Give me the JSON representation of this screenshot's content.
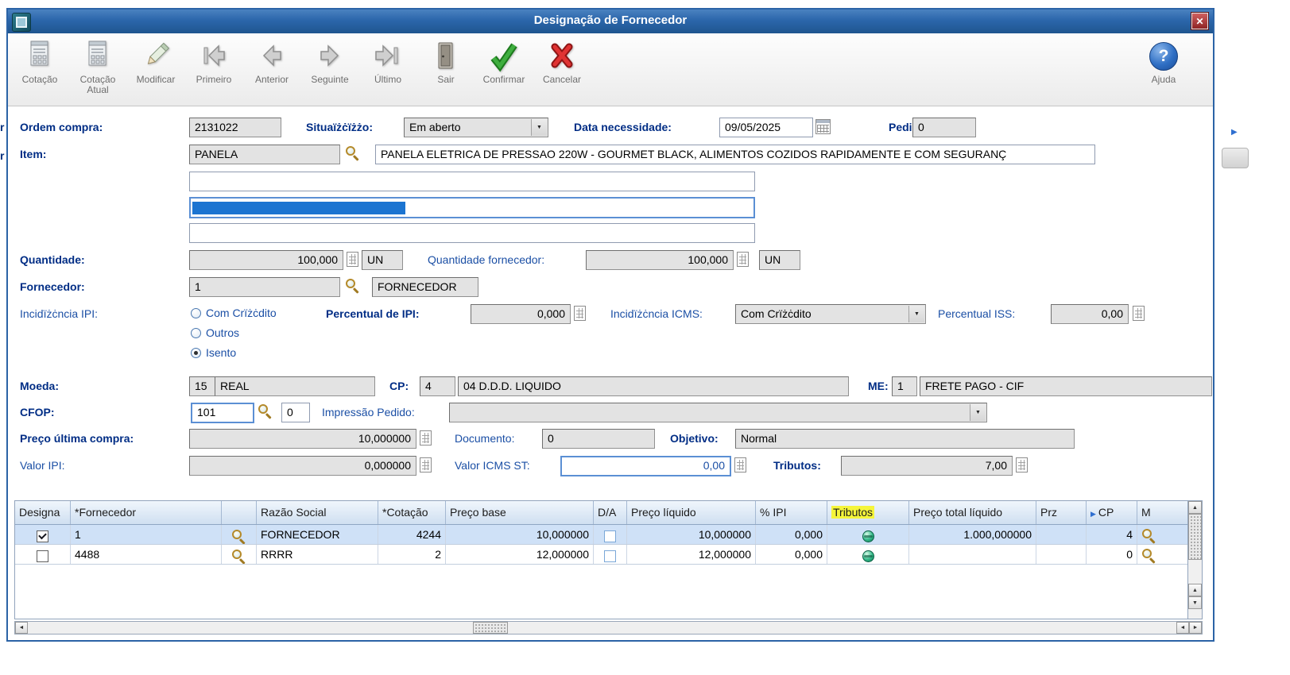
{
  "window": {
    "title": "Designação de Fornecedor"
  },
  "icons": {
    "close": "✕",
    "help": "?",
    "up_arrow": "▲",
    "down_arrow": "▼",
    "left_arrow": "◄",
    "right_arrow": "►",
    "dropdown_arrow": "▼",
    "focus_arrow": "▶"
  },
  "background": {
    "left_fragment_1": "r",
    "left_fragment_2": "r"
  },
  "toolbar": {
    "cotacao": "Cotação",
    "cotacao_atual_line1": "Cotação",
    "cotacao_atual_line2": "Atual",
    "modificar": "Modificar",
    "primeiro": "Primeiro",
    "anterior": "Anterior",
    "seguinte": "Seguinte",
    "ultimo": "Último",
    "sair": "Sair",
    "confirmar": "Confirmar",
    "cancelar": "Cancelar",
    "ajuda": "Ajuda"
  },
  "form": {
    "ordem_compra_label": "Ordem compra:",
    "ordem_compra_value": "2131022",
    "situacao_label": "Situaïżċïżżo:",
    "situacao_value": "Em aberto",
    "data_necessidade_label": "Data necessidade:",
    "data_necessidade_value": "09/05/2025",
    "pedido_label": "Pedido:",
    "pedido_value": "0",
    "item_label": "Item:",
    "item_value": "PANELA",
    "item_descricao": "PANELA ELETRICA DE PRESSAO 220W - GOURMET BLACK, ALIMENTOS COZIDOS RAPIDAMENTE E COM SEGURANÇ",
    "quantidade_label": "Quantidade:",
    "quantidade_value": "100,000",
    "quantidade_un": "UN",
    "quantidade_fornecedor_label": "Quantidade fornecedor:",
    "quantidade_fornecedor_value": "100,000",
    "quantidade_fornecedor_un": "UN",
    "fornecedor_label": "Fornecedor:",
    "fornecedor_codigo": "1",
    "fornecedor_nome": "FORNECEDOR",
    "incidencia_ipi_label": "Incidïżċncia IPI:",
    "radio_com_credito": "Com Crïżċdito",
    "radio_outros": "Outros",
    "radio_isento": "Isento",
    "percentual_ipi_label": "Percentual de IPI:",
    "percentual_ipi_value": "0,000",
    "incidencia_icms_label": "Incidïżċncia ICMS:",
    "incidencia_icms_value": "Com Crïżċdito",
    "percentual_iss_label": "Percentual ISS:",
    "percentual_iss_value": "0,00",
    "moeda_label": "Moeda:",
    "moeda_codigo": "15",
    "moeda_nome": "REAL",
    "cp_label": "CP:",
    "cp_codigo": "4",
    "cp_descricao": "04 D.D.D. LIQUIDO",
    "me_label": "ME:",
    "me_codigo": "1",
    "me_descricao": "FRETE PAGO - CIF",
    "cfop_label": "CFOP:",
    "cfop_value": "101",
    "cfop_extra": "0",
    "impressao_pedido_label": "Impressão Pedido:",
    "impressao_pedido_value": "",
    "preco_ultima_compra_label": "Preço  última compra:",
    "preco_ultima_compra_value": "10,000000",
    "documento_label": "Documento:",
    "documento_value": "0",
    "objetivo_label": "Objetivo:",
    "objetivo_value": "Normal",
    "valor_ipi_label": "Valor IPI:",
    "valor_ipi_value": "0,000000",
    "valor_icms_st_label": "Valor ICMS ST:",
    "valor_icms_st_value": "0,00",
    "tributos_label": "Tributos:",
    "tributos_value": "7,00"
  },
  "grid": {
    "headers": [
      "Designa",
      "*Fornecedor",
      "",
      "Razão Social",
      "*Cotação",
      "Preço base",
      "D/A",
      "Preço líquido",
      "% IPI",
      "Tributos",
      "Preço total líquido",
      "Prz",
      "CP",
      "M"
    ],
    "rows": [
      {
        "designa_checked": true,
        "fornecedor": "1",
        "razao": "FORNECEDOR",
        "cotacao": "4244",
        "preco_base": "10,000000",
        "da_checked": false,
        "preco_liquido": "10,000000",
        "perc_ipi": "0,000",
        "preco_total": "1.000,000000",
        "prz": "",
        "cp": "4"
      },
      {
        "designa_checked": false,
        "fornecedor": "4488",
        "razao": "RRRR",
        "cotacao": "2",
        "preco_base": "12,000000",
        "da_checked": false,
        "preco_liquido": "12,000000",
        "perc_ipi": "0,000",
        "preco_total": "",
        "prz": "",
        "cp": "0"
      }
    ]
  }
}
